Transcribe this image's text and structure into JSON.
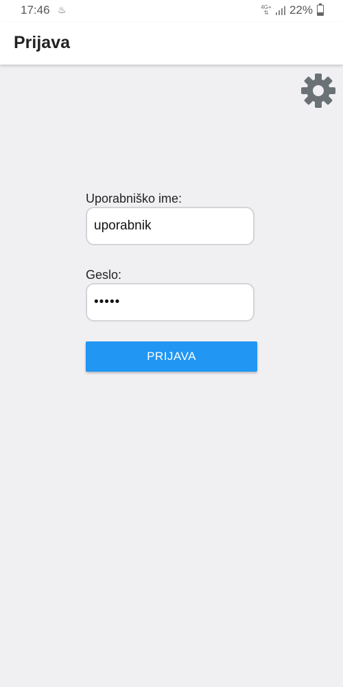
{
  "status_bar": {
    "time": "17:46",
    "network_label": "4G+",
    "battery_percent": "22%",
    "icons": [
      "notification-icon",
      "network-icon",
      "signal-icon",
      "battery-icon"
    ]
  },
  "app_bar": {
    "title": "Prijava"
  },
  "settings": {
    "icon": "gear-icon",
    "color": "#6b7276"
  },
  "form": {
    "username_label": "Uporabniško ime:",
    "username_value": "uporabnik",
    "password_label": "Geslo:",
    "password_value": "•••••",
    "submit_label": "PRIJAVA"
  },
  "colors": {
    "accent": "#2196f3",
    "background": "#f0f0f3"
  }
}
